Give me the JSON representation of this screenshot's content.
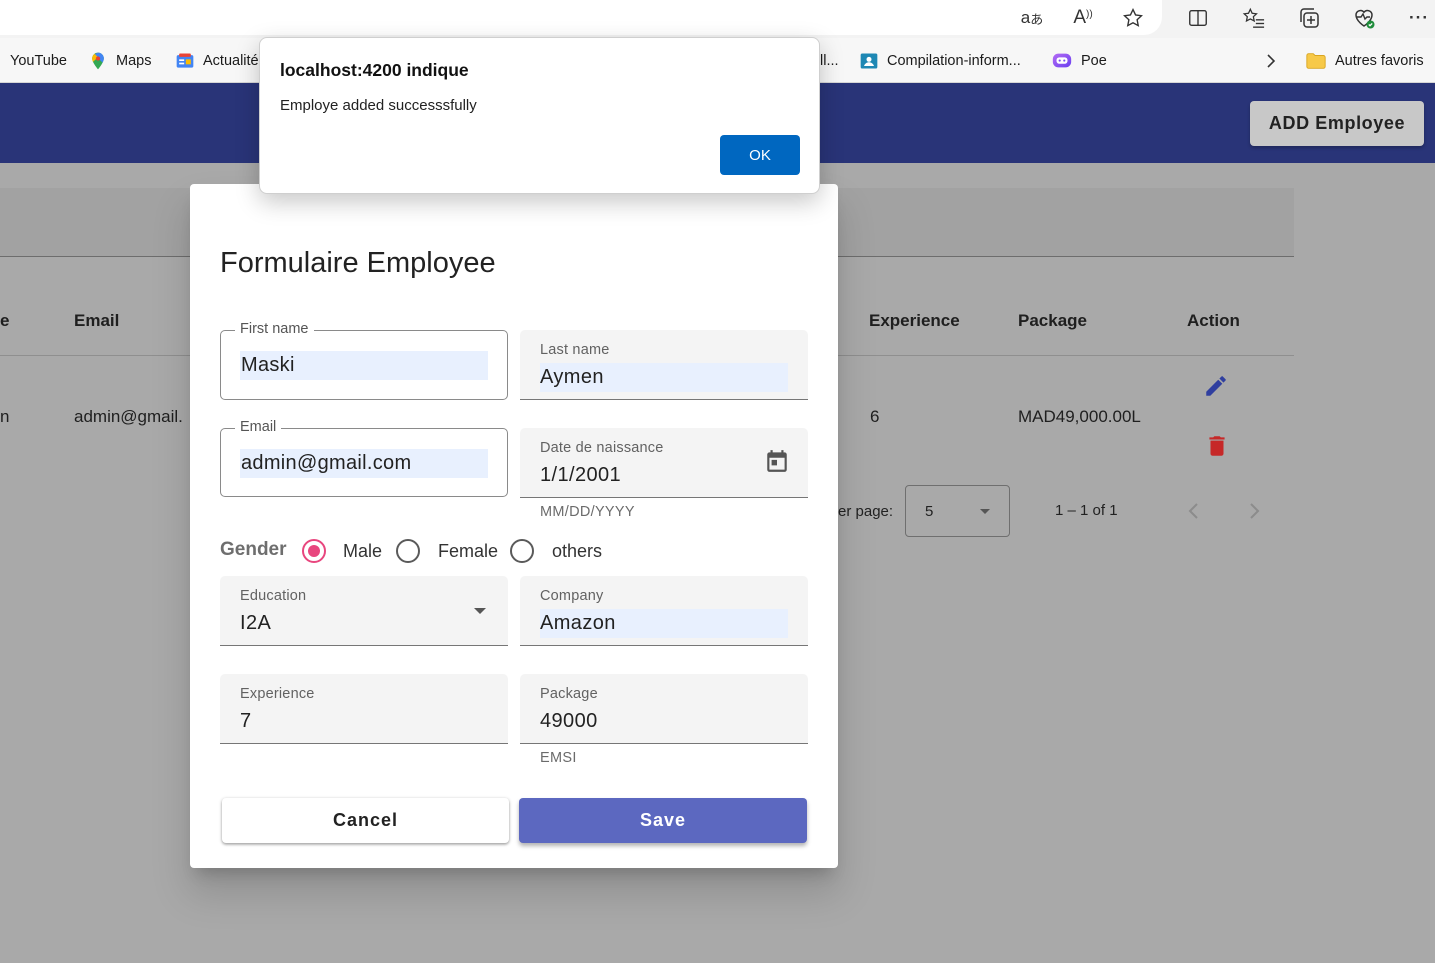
{
  "browser": {
    "bookmarks": [
      {
        "label": "YouTube",
        "icon": "none"
      },
      {
        "label": "Maps",
        "icon": "maps-pin-icon"
      },
      {
        "label": "Actualité",
        "icon": "news-icon"
      },
      {
        "label": "ll...",
        "icon": "none"
      },
      {
        "label": "Compilation-inform...",
        "icon": "classroom-icon"
      },
      {
        "label": "Poe",
        "icon": "poe-icon"
      }
    ],
    "other_favorites": "Autres favoris",
    "toolbar_icons": [
      "translate-icon",
      "read-aloud-icon",
      "favorite-star-icon",
      "split-screen-icon",
      "favorites-list-icon",
      "collections-icon",
      "browser-health-icon",
      "more-options-icon"
    ]
  },
  "app": {
    "add_button": "ADD Employee",
    "table": {
      "headers": {
        "partial": "e",
        "email": "Email",
        "experience": "Experience",
        "package": "Package",
        "action": "Action"
      },
      "rows": [
        {
          "partial": "n",
          "email": "admin@gmail.",
          "experience": "6",
          "package": "MAD49,000.00L"
        }
      ]
    },
    "paginator": {
      "items_per_page_label": "er page:",
      "page_size": "5",
      "range": "1 – 1 of 1"
    }
  },
  "dialog": {
    "title": "Formulaire Employee",
    "first_name": {
      "label": "First name",
      "value": "Maski"
    },
    "last_name": {
      "label": "Last name",
      "value": "Aymen"
    },
    "email": {
      "label": "Email",
      "value": "admin@gmail.com"
    },
    "dob": {
      "label": "Date de naissance",
      "value": "1/1/2001",
      "hint": "MM/DD/YYYY"
    },
    "gender": {
      "label": "Gender",
      "options": [
        "Male",
        "Female",
        "others"
      ],
      "selected": "Male"
    },
    "education": {
      "label": "Education",
      "value": "I2A"
    },
    "company": {
      "label": "Company",
      "value": "Amazon"
    },
    "experience": {
      "label": "Experience",
      "value": "7"
    },
    "package": {
      "label": "Package",
      "value": "49000",
      "hint": "EMSI"
    },
    "cancel": "Cancel",
    "save": "Save"
  },
  "alert": {
    "title": "localhost:4200 indique",
    "message": "Employe added successsfully",
    "ok": "OK"
  },
  "colors": {
    "header": "#293478",
    "accent": "#e8467e",
    "save": "#5c68c0",
    "ok": "#0067c0",
    "delete": "#c62828",
    "edit": "#303f9f"
  }
}
